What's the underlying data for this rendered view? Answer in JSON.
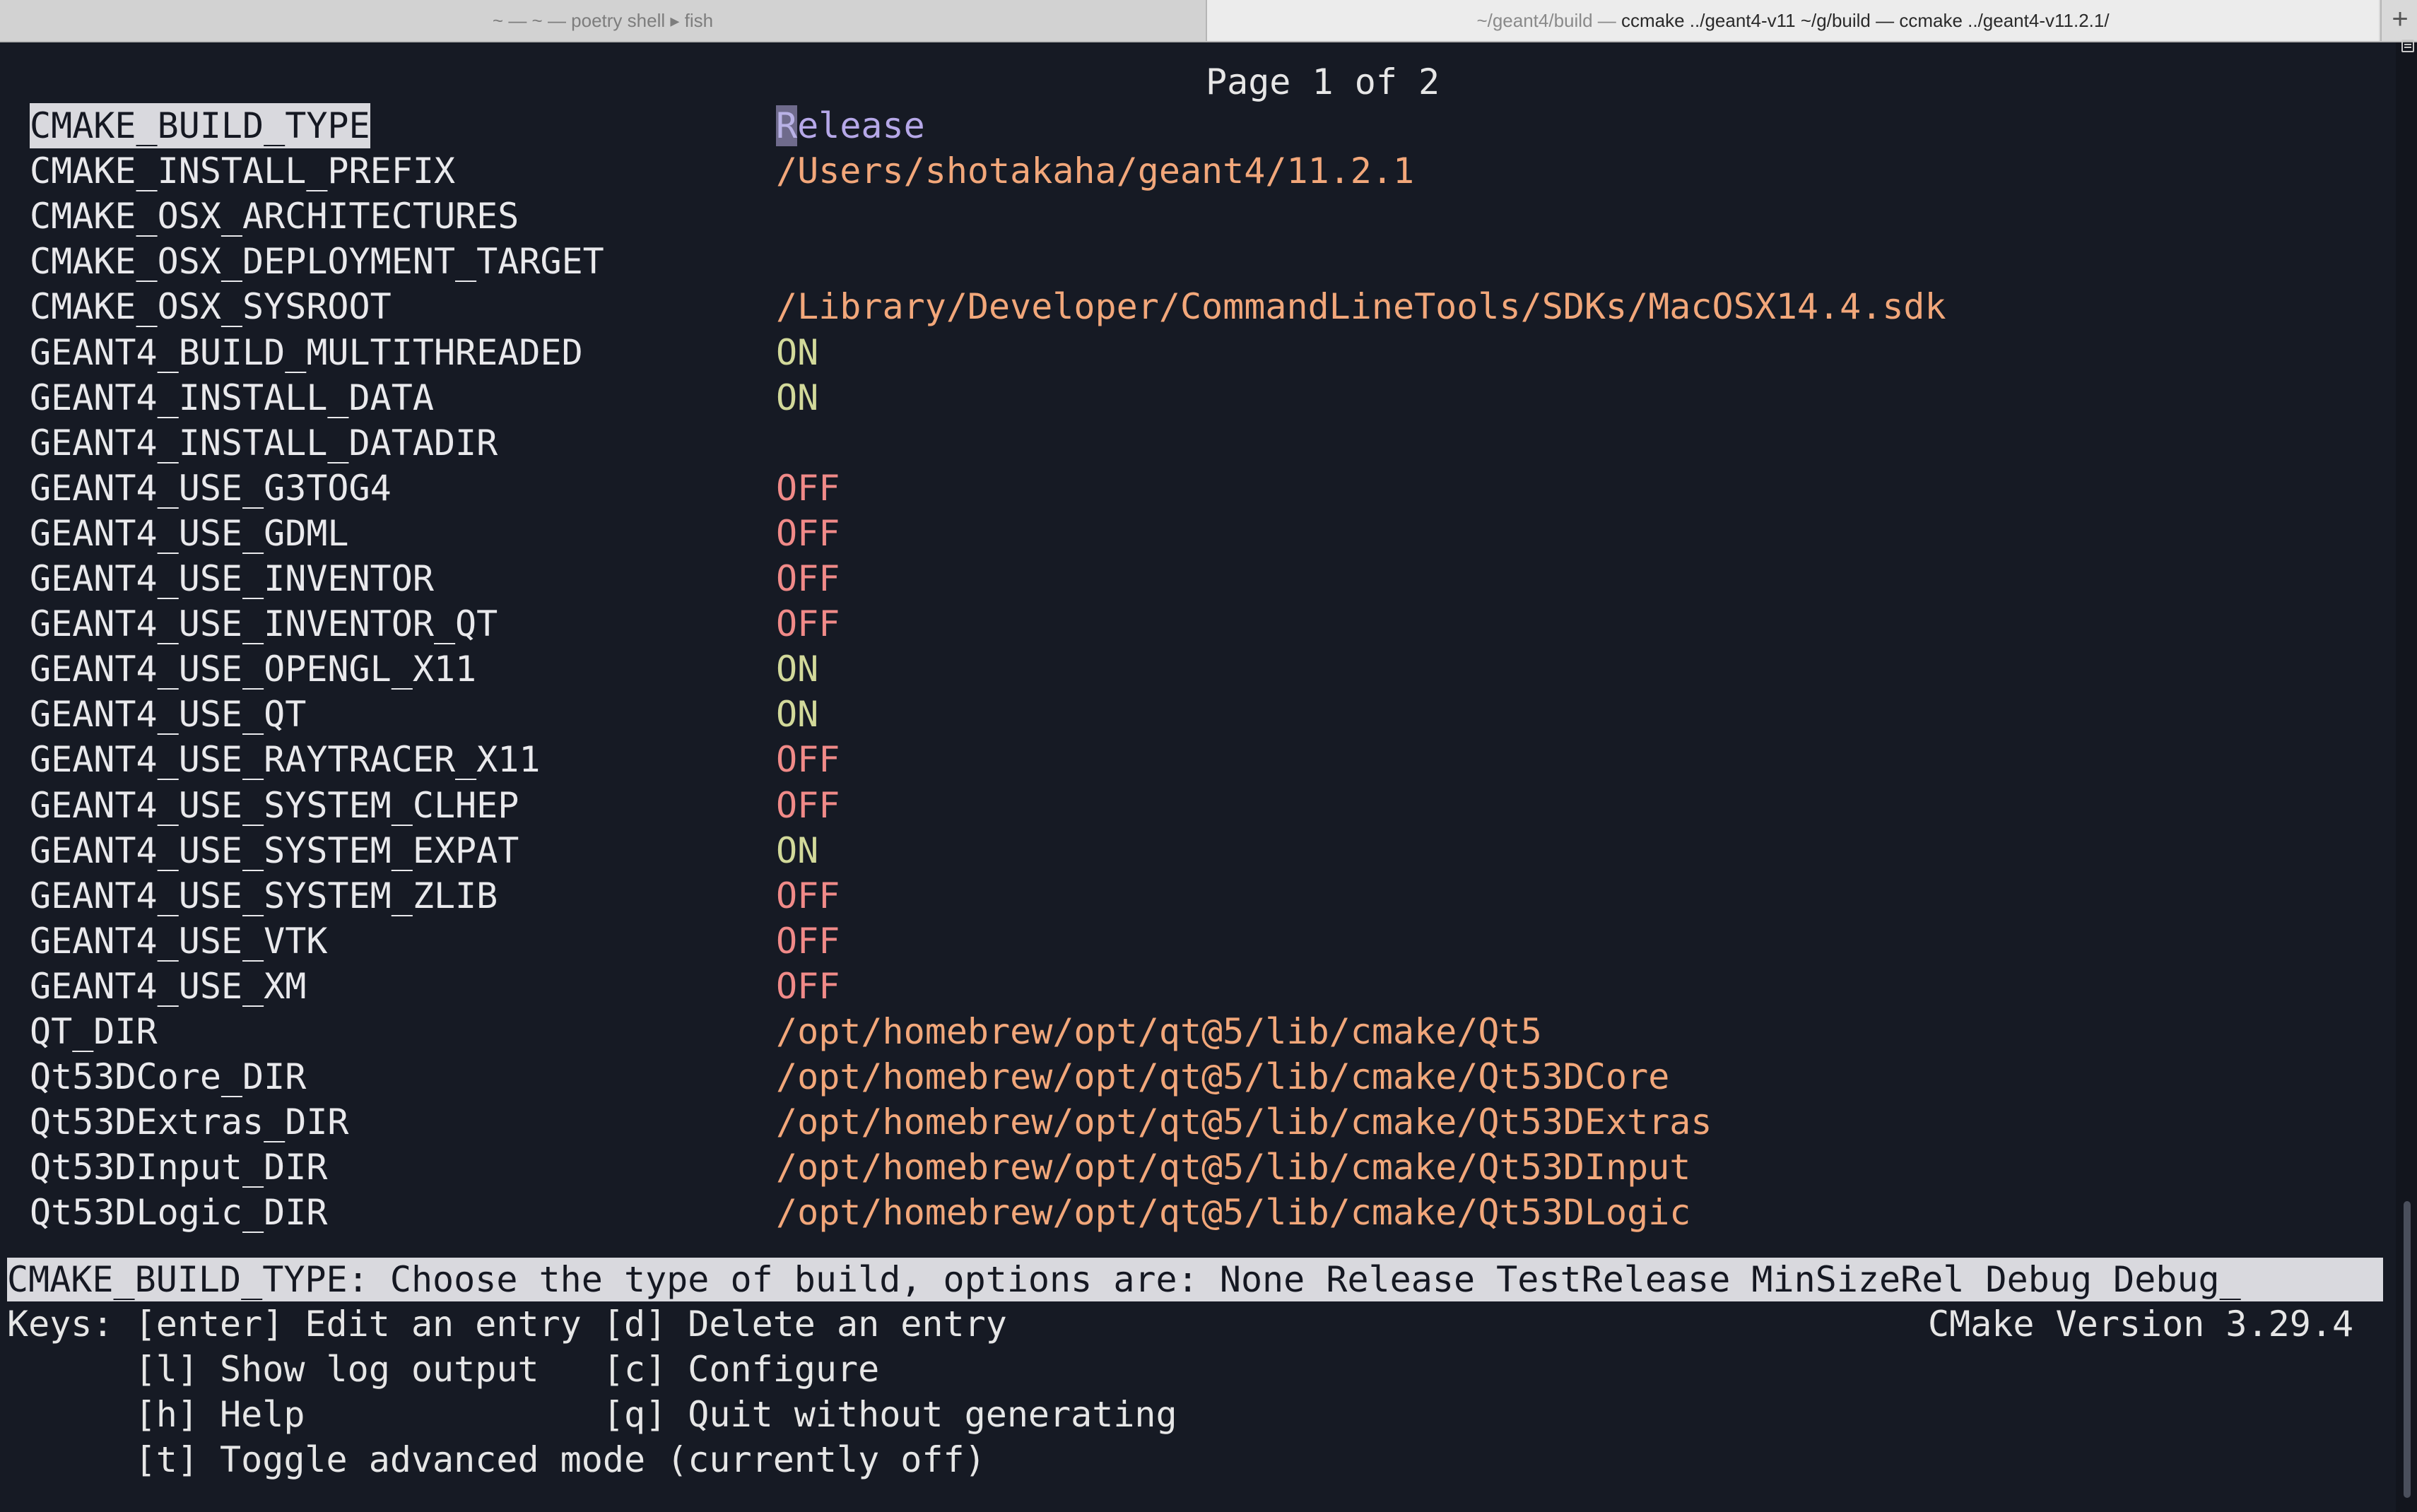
{
  "tabs": [
    {
      "label": "~ — ~ — poetry shell ▸ fish"
    },
    {
      "prefix": "~/geant4/build — ",
      "label": "ccmake ../geant4-v11 ~/g/build — ccmake ../geant4-v11.2.1/"
    }
  ],
  "new_tab_label": "+",
  "page_indicator": "Page 1 of 2",
  "entries": [
    {
      "name": "CMAKE_BUILD_TYPE",
      "value": "Release",
      "kind": "path",
      "selected": true
    },
    {
      "name": "CMAKE_INSTALL_PREFIX",
      "value": "/Users/shotakaha/geant4/11.2.1",
      "kind": "path"
    },
    {
      "name": "CMAKE_OSX_ARCHITECTURES",
      "value": "",
      "kind": "path"
    },
    {
      "name": "CMAKE_OSX_DEPLOYMENT_TARGET",
      "value": "",
      "kind": "path"
    },
    {
      "name": "CMAKE_OSX_SYSROOT",
      "value": "/Library/Developer/CommandLineTools/SDKs/MacOSX14.4.sdk",
      "kind": "path"
    },
    {
      "name": "GEANT4_BUILD_MULTITHREADED",
      "value": "ON",
      "kind": "on"
    },
    {
      "name": "GEANT4_INSTALL_DATA",
      "value": "ON",
      "kind": "on"
    },
    {
      "name": "GEANT4_INSTALL_DATADIR",
      "value": "",
      "kind": "path"
    },
    {
      "name": "GEANT4_USE_G3TOG4",
      "value": "OFF",
      "kind": "off"
    },
    {
      "name": "GEANT4_USE_GDML",
      "value": "OFF",
      "kind": "off"
    },
    {
      "name": "GEANT4_USE_INVENTOR",
      "value": "OFF",
      "kind": "off"
    },
    {
      "name": "GEANT4_USE_INVENTOR_QT",
      "value": "OFF",
      "kind": "off"
    },
    {
      "name": "GEANT4_USE_OPENGL_X11",
      "value": "ON",
      "kind": "on"
    },
    {
      "name": "GEANT4_USE_QT",
      "value": "ON",
      "kind": "on"
    },
    {
      "name": "GEANT4_USE_RAYTRACER_X11",
      "value": "OFF",
      "kind": "off"
    },
    {
      "name": "GEANT4_USE_SYSTEM_CLHEP",
      "value": "OFF",
      "kind": "off"
    },
    {
      "name": "GEANT4_USE_SYSTEM_EXPAT",
      "value": "ON",
      "kind": "on"
    },
    {
      "name": "GEANT4_USE_SYSTEM_ZLIB",
      "value": "OFF",
      "kind": "off"
    },
    {
      "name": "GEANT4_USE_VTK",
      "value": "OFF",
      "kind": "off"
    },
    {
      "name": "GEANT4_USE_XM",
      "value": "OFF",
      "kind": "off"
    },
    {
      "name": "QT_DIR",
      "value": "/opt/homebrew/opt/qt@5/lib/cmake/Qt5",
      "kind": "path"
    },
    {
      "name": "Qt53DCore_DIR",
      "value": "/opt/homebrew/opt/qt@5/lib/cmake/Qt53DCore",
      "kind": "path"
    },
    {
      "name": "Qt53DExtras_DIR",
      "value": "/opt/homebrew/opt/qt@5/lib/cmake/Qt53DExtras",
      "kind": "path"
    },
    {
      "name": "Qt53DInput_DIR",
      "value": "/opt/homebrew/opt/qt@5/lib/cmake/Qt53DInput",
      "kind": "path"
    },
    {
      "name": "Qt53DLogic_DIR",
      "value": "/opt/homebrew/opt/qt@5/lib/cmake/Qt53DLogic",
      "kind": "path"
    }
  ],
  "help_text": "CMAKE_BUILD_TYPE: Choose the type of build, options are: None Release TestRelease MinSizeRel Debug Debug_",
  "keys": {
    "line1": "Keys: [enter] Edit an entry [d] Delete an entry",
    "line2": "      [l] Show log output   [c] Configure",
    "line3": "      [h] Help              [q] Quit without generating",
    "line4": "      [t] Toggle advanced mode (currently off)"
  },
  "version": "CMake Version 3.29.4",
  "colors": {
    "background": "#161a24",
    "path_value": "#f2a77a",
    "on_value": "#d2d99a",
    "off_value": "#f08a88",
    "selection": "#d9d9de"
  }
}
